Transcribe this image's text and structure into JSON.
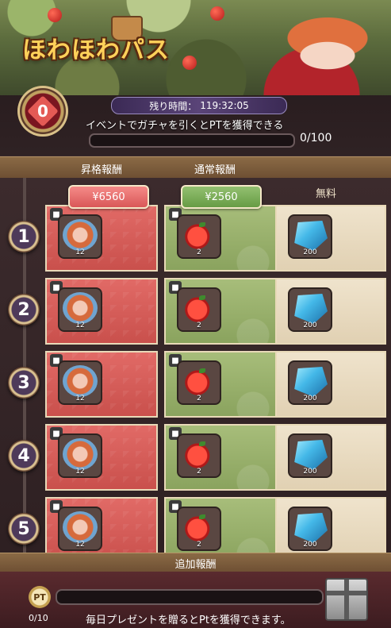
{
  "banner": {
    "title": "ほわほわパス"
  },
  "status": {
    "level": "0",
    "timer_label": "残り時間：",
    "timer_value": "119:32:05",
    "event_text": "イベントでガチャを引くとPTを獲得できる",
    "progress_text": "0/100",
    "progress_fraction": 0
  },
  "columns": {
    "premium_header": "昇格報酬",
    "normal_header": "通常報酬",
    "free_header": "無料",
    "premium_price": "¥6560",
    "normal_price": "¥2560"
  },
  "rows": [
    {
      "level": "1",
      "premium_qty": "12",
      "normal_qty": "2",
      "free_qty": "200"
    },
    {
      "level": "2",
      "premium_qty": "12",
      "normal_qty": "2",
      "free_qty": "200"
    },
    {
      "level": "3",
      "premium_qty": "12",
      "normal_qty": "2",
      "free_qty": "200"
    },
    {
      "level": "4",
      "premium_qty": "12",
      "normal_qty": "2",
      "free_qty": "200"
    },
    {
      "level": "5",
      "premium_qty": "12",
      "normal_qty": "2",
      "free_qty": "200"
    }
  ],
  "items": {
    "premium_icon": "character-portrait-icon",
    "normal_icon": "apple-icon",
    "free_icon": "blue-gem-icon",
    "lock_icon": "lock-icon"
  },
  "extra": {
    "label": "追加報酬"
  },
  "footer": {
    "pt_label": "PT",
    "pt_count": "0/10",
    "pt_fraction": 0,
    "hint": "毎日プレゼントを贈るとPtを獲得できます。",
    "gift_icon": "gift-box-icon"
  },
  "colors": {
    "premium": "#d95858",
    "normal": "#8aa35e",
    "free": "#e8dcc4",
    "timer": "#4a3a66"
  }
}
